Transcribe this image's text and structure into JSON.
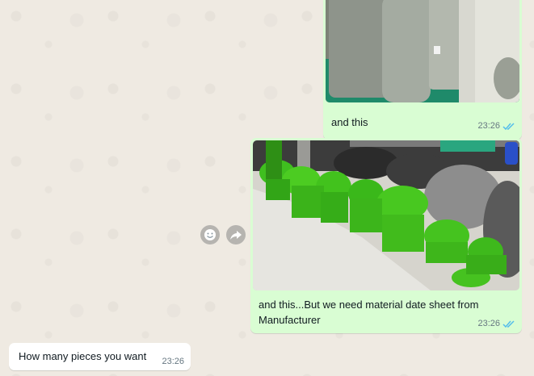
{
  "messages": [
    {
      "direction": "outgoing",
      "type": "image",
      "caption": "and this",
      "time": "23:26",
      "status": "read"
    },
    {
      "direction": "outgoing",
      "type": "image",
      "caption": "and this...But we need material date sheet from Manufacturer",
      "time": "23:26",
      "status": "read"
    },
    {
      "direction": "incoming",
      "type": "text",
      "caption": "How many pieces you want",
      "time": "23:26"
    }
  ],
  "actions": {
    "emoji_icon": "smiley-icon",
    "forward_icon": "forward-icon"
  },
  "colors": {
    "outgoing_bubble": "#d9fdd3",
    "incoming_bubble": "#ffffff",
    "chat_background": "#efeae2",
    "read_ticks": "#53bdeb",
    "timestamp": "#667781"
  }
}
